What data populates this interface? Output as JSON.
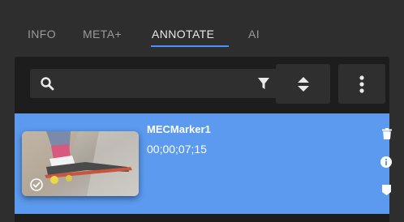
{
  "tabs": [
    {
      "label": "INFO"
    },
    {
      "label": "META+"
    },
    {
      "label": "ANNOTATE"
    },
    {
      "label": "AI"
    }
  ],
  "active_tab": "ANNOTATE",
  "search": {
    "placeholder": "",
    "value": ""
  },
  "markers": [
    {
      "name": "MECMarker1",
      "timecode": "00;00;07;15",
      "selected": true
    }
  ],
  "colors": {
    "background": "#2e2e2e",
    "panel": "#1d1d1d",
    "control": "#2f2f2f",
    "accent": "#4a90ff",
    "selected_row": "#5b9aef",
    "text_active": "#e8e8e8",
    "text_inactive": "#9a9a9a"
  },
  "icons": [
    "search-icon",
    "filter-icon",
    "sort-icon",
    "more-vertical-icon",
    "check-circle-icon",
    "trash-icon",
    "info-icon",
    "tag-icon"
  ]
}
